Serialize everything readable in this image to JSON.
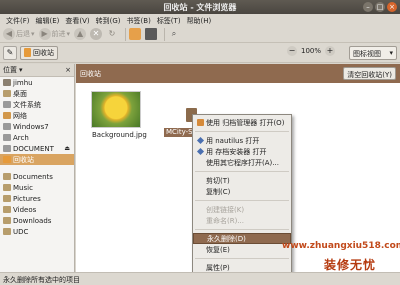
{
  "window": {
    "title": "回收站 - 文件浏览器"
  },
  "menubar": [
    "文件(F)",
    "编辑(E)",
    "查看(V)",
    "转到(G)",
    "书签(B)",
    "标签(T)",
    "帮助(H)"
  ],
  "toolbar": {
    "back": "后退",
    "forward": "前进"
  },
  "location": {
    "crumb": "回收站",
    "zoom": "100%",
    "view": "图标视图"
  },
  "sidebar": {
    "header": "位置",
    "items": [
      "jimhu",
      "桌面",
      "文件系统",
      "网络",
      "Windows7",
      "Arch",
      "DOCUMENT",
      "回收站",
      "Documents",
      "Music",
      "Pictures",
      "Videos",
      "Downloads",
      "UDC"
    ]
  },
  "content": {
    "banner": "回收站",
    "empty_button": "清空回收站(Y)",
    "files": [
      {
        "label": "Background.jpg"
      },
      {
        "label": "MCity-S"
      }
    ]
  },
  "context_menu": {
    "items": [
      "使用 归档管理器 打开(O)",
      "用 nautilus 打开",
      "用 存档安装器 打开",
      "使用其它程序打开(A)...",
      "剪切(T)",
      "复制(C)",
      "创建链接(K)",
      "重命名(R)...",
      "永久删除(D)",
      "恢复(E)",
      "属性(P)"
    ]
  },
  "statusbar": {
    "text": "永久删除所有选中的项目"
  },
  "watermark": {
    "url": "www.zhuangxiu518.com",
    "slogan": "装修无忧"
  }
}
